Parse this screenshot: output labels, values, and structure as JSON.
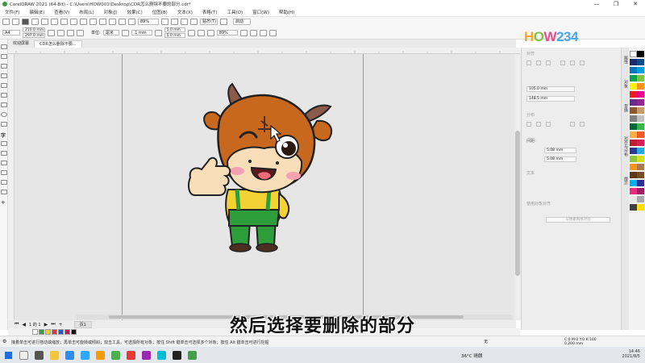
{
  "window": {
    "title": "CorelDRAW 2021 (64-Bit) - C:\\Users\\HOW001\\Desktop\\CDR怎么删除不要的部分.cdr*",
    "controls": [
      "—",
      "❐",
      "✕"
    ]
  },
  "menu": [
    "文件(F)",
    "编辑(E)",
    "查看(V)",
    "布局(L)",
    "对象(J)",
    "效果(C)",
    "位图(B)",
    "文本(X)",
    "表格(T)",
    "工具(O)",
    "窗口(W)",
    "帮助(H)"
  ],
  "toolbar": {
    "zoom": "89%",
    "snap_label": "贴齐(T)",
    "launch_label": "启动"
  },
  "propertybar": {
    "page_size": "A4",
    "width": "210.0 mm",
    "height": "297.0 mm",
    "units_label": "单位:",
    "units": "毫米",
    "nudge": ".1 mm",
    "dup_x": "5.0 mm",
    "dup_y": "5.0 mm",
    "zoom2": "89%"
  },
  "tabs": [
    {
      "label": "欢迎屏幕",
      "active": false
    },
    {
      "label": "CDR怎么删除不要...",
      "active": true
    }
  ],
  "ruler": {
    "unit": "毫米"
  },
  "pagenav": {
    "page_of": "1 的 1",
    "page_tab": "页1"
  },
  "docker": {
    "section_transform": "对齐",
    "x_value": "105.0 mm",
    "y_value": "148.5 mm",
    "section_distribute": "分布",
    "spacing_label": "间距:",
    "spacing1": "5.08 mm",
    "spacing2": "5.08 mm",
    "section_text": "文本",
    "checkbox_label": "使用对象对齐",
    "button_label": "与像素网格对齐"
  },
  "docker_tabs": [
    "属性",
    "对象",
    "变换",
    "对齐与分布",
    "提示"
  ],
  "logo": {
    "h": "H",
    "o": "O",
    "w": "W",
    "n": "234"
  },
  "subtitle": "然后选择要删除的部分",
  "status": {
    "hint": "接着单击可进行拖动或缩放；再单击可旋转或倾斜；双击工具，可选择所有对象；按住 Shift 键单击可选择多个对象；按住 Alt 键单击可进行挖掘",
    "fill_label": "无",
    "cmyk": "C:0 M:0 Y:0 K:100",
    "stroke": "0.200 mm"
  },
  "taskbar": {
    "weather": "36°C 晴朗",
    "time": "14:46",
    "date": "2021/8/5"
  },
  "colors": {
    "accent": "#3a9b3a",
    "canvas": "#e6e6e6",
    "page": "#9a9a9a"
  }
}
